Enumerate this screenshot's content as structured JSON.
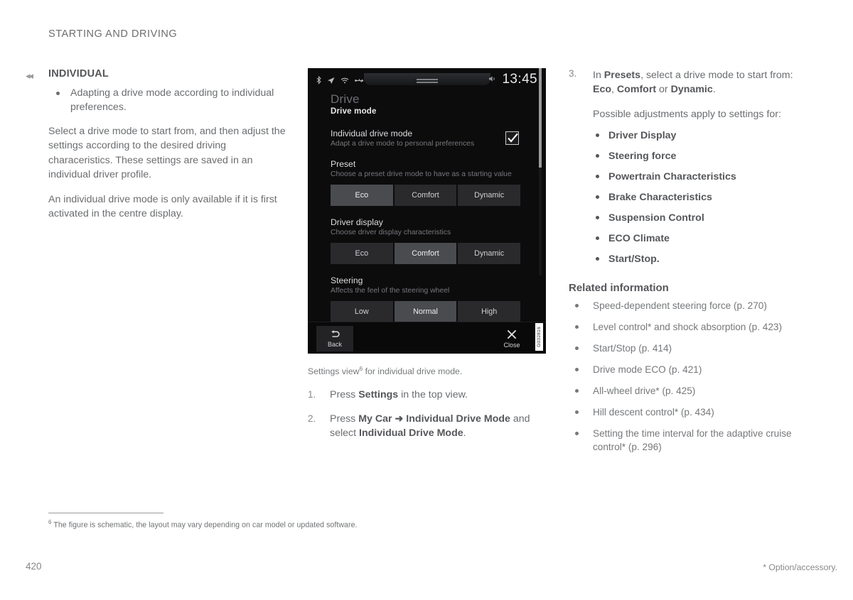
{
  "header": {
    "chapter": "STARTING AND DRIVING"
  },
  "left": {
    "prev_arrow_icon": "double-left-arrow-icon",
    "section_title": "INDIVIDUAL",
    "bullets": [
      "Adapting a drive mode according to individual preferences."
    ],
    "paragraphs": [
      "Select a drive mode to start from, and then adjust the settings according to the desired driving characeristics. These settings are saved in an individual driver profile.",
      "An individual drive mode is only available if it is first activated in the centre display."
    ]
  },
  "figure": {
    "screen": {
      "status_icons": [
        "bluetooth-icon",
        "navigation-arrow-icon",
        "wifi-icon",
        "usb-icon"
      ],
      "volume_icon": "speaker-icon",
      "clock": "13:45",
      "title": "Drive",
      "subtitle": "Drive mode",
      "rows": [
        {
          "title": "Individual drive mode",
          "desc": "Adapt a drive mode to personal preferences",
          "checkbox": true
        },
        {
          "title": "Preset",
          "desc": "Choose a preset drive mode to have as a starting value",
          "options": [
            "Eco",
            "Comfort",
            "Dynamic"
          ],
          "selected": "Eco"
        },
        {
          "title": "Driver display",
          "desc": "Choose driver display characteristics",
          "options": [
            "Eco",
            "Comfort",
            "Dynamic"
          ],
          "selected": "Comfort"
        },
        {
          "title": "Steering",
          "desc": "Affects the feel of the steering wheel",
          "options": [
            "Low",
            "Normal",
            "High"
          ],
          "selected": "Normal"
        }
      ],
      "back_label": "Back",
      "back_icon": "back-arrow-icon",
      "close_label": "Close",
      "close_icon": "close-x-icon",
      "image_code": "G032816"
    },
    "caption_pre": "Settings view",
    "caption_footnote_marker": "6",
    "caption_post": " for individual drive mode.",
    "steps": [
      {
        "num": "1.",
        "parts": [
          {
            "t": "Press ",
            "b": false
          },
          {
            "t": "Settings",
            "b": true
          },
          {
            "t": " in the top view.",
            "b": false
          }
        ]
      },
      {
        "num": "2.",
        "parts": [
          {
            "t": "Press ",
            "b": false
          },
          {
            "t": "My Car ➜ Individual Drive Mode",
            "b": true
          },
          {
            "t": " and select ",
            "b": false
          },
          {
            "t": "Individual Drive Mode",
            "b": true
          },
          {
            "t": ".",
            "b": false
          }
        ]
      }
    ]
  },
  "right": {
    "step": {
      "num": "3.",
      "parts": [
        {
          "t": "In ",
          "b": false
        },
        {
          "t": "Presets",
          "b": true
        },
        {
          "t": ", select a drive mode to start from: ",
          "b": false
        },
        {
          "t": "Eco",
          "b": true
        },
        {
          "t": ", ",
          "b": false
        },
        {
          "t": "Comfort",
          "b": true
        },
        {
          "t": " or ",
          "b": false
        },
        {
          "t": "Dynamic",
          "b": true
        },
        {
          "t": ".",
          "b": false
        }
      ]
    },
    "subtext": "Possible adjustments apply to settings for:",
    "adjustments": [
      "Driver Display",
      "Steering force",
      "Powertrain Characteristics",
      "Brake Characteristics",
      "Suspension Control",
      "ECO Climate",
      "Start/Stop."
    ],
    "related_heading": "Related information",
    "related_links": [
      "Speed-dependent steering force (p. 270)",
      "Level control* and shock absorption (p. 423)",
      "Start/Stop (p. 414)",
      "Drive mode ECO (p. 421)",
      "All-wheel drive* (p. 425)",
      "Hill descent control* (p. 434)",
      "Setting the time interval for the adaptive cruise control* (p. 296)"
    ]
  },
  "footnote": {
    "marker": "6",
    "text": "The figure is schematic, the layout may vary depending on car model or updated software."
  },
  "footer": {
    "page_number": "420",
    "option_note": "* Option/accessory."
  },
  "colors": {
    "page_bg": "#ffffff",
    "body_text": "#6b6d70",
    "bold_text": "#55575a",
    "screen_bg": "#0c0c0d",
    "segment_selected": "#4a4b4e",
    "segment_unselected": "#2a2a2d"
  }
}
